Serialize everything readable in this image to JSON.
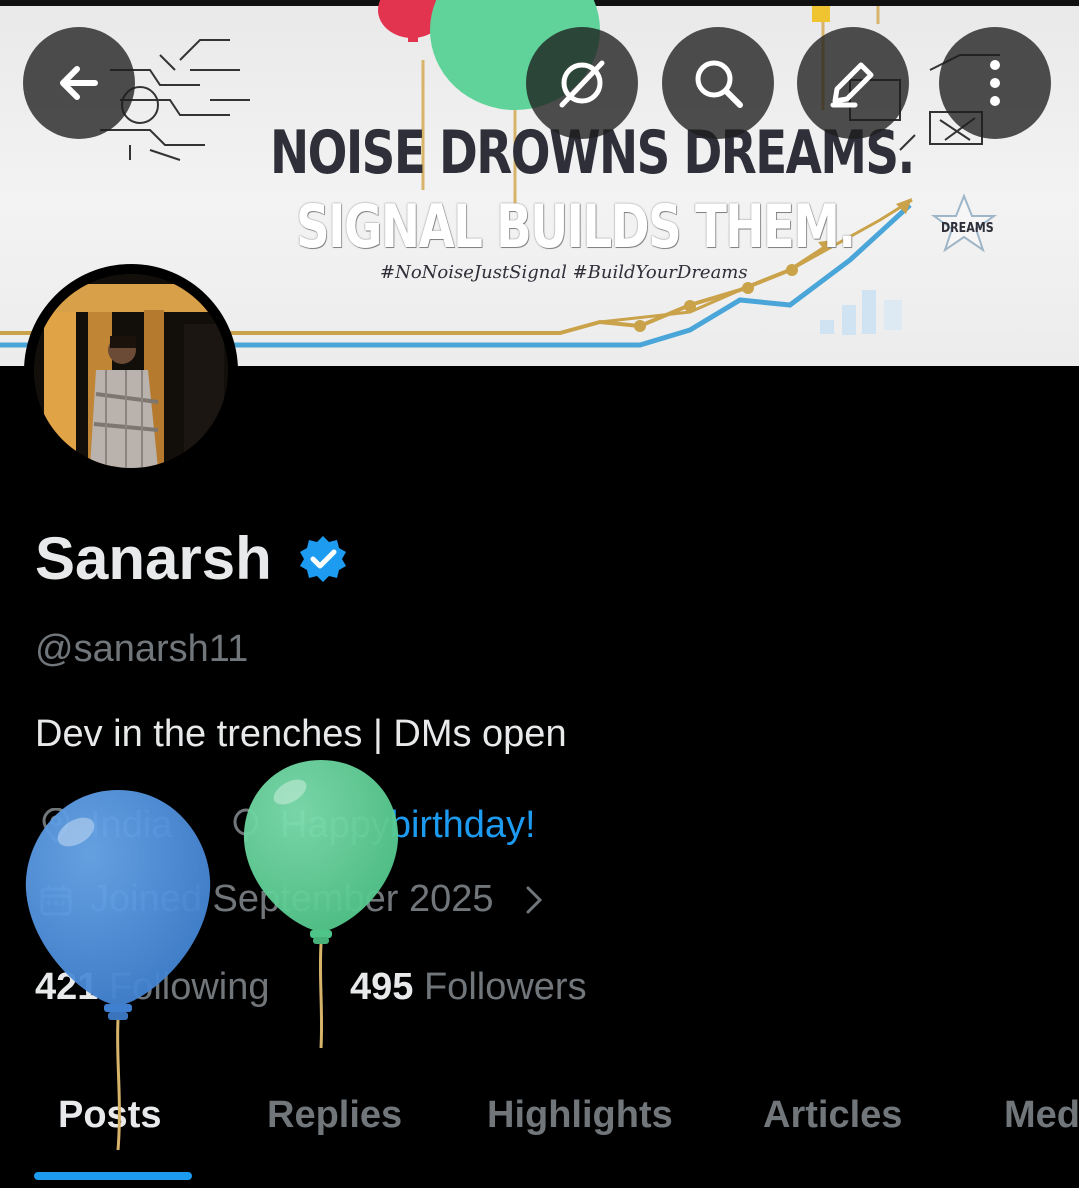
{
  "banner": {
    "line1": "NOISE DROWNS DREAMS.",
    "line2": "SIGNAL BUILDS THEM.",
    "hashtags": "#NoNoiseJustSignal #BuildYourDreams",
    "badge": "DREAMS"
  },
  "top_bar": {
    "back_icon": "arrow-left-icon",
    "grok_icon": "grok-icon",
    "search_icon": "search-icon",
    "edit_icon": "pencil-icon",
    "more_icon": "more-vertical-icon"
  },
  "profile": {
    "display_name": "Sanarsh",
    "handle": "@sanarsh11",
    "bio": "Dev in the trenches | DMs open",
    "location": "India",
    "birthday_prefix": "Happy",
    "birthday_link": " birthday!",
    "joined": "Joined September 2025",
    "following_count": "421",
    "following_label": "Following",
    "followers_count": "495",
    "followers_label": "Followers",
    "verified_color": "#1d9bf0"
  },
  "tabs": [
    {
      "label": "Posts",
      "active": true
    },
    {
      "label": "Replies",
      "active": false
    },
    {
      "label": "Highlights",
      "active": false
    },
    {
      "label": "Articles",
      "active": false
    },
    {
      "label": "Med",
      "active": false
    }
  ],
  "colors": {
    "accent": "#1d9bf0",
    "muted": "#71767b",
    "text": "#e7e9ea",
    "balloon_blue": "#4a90e2",
    "balloon_green": "#5fd39a"
  }
}
